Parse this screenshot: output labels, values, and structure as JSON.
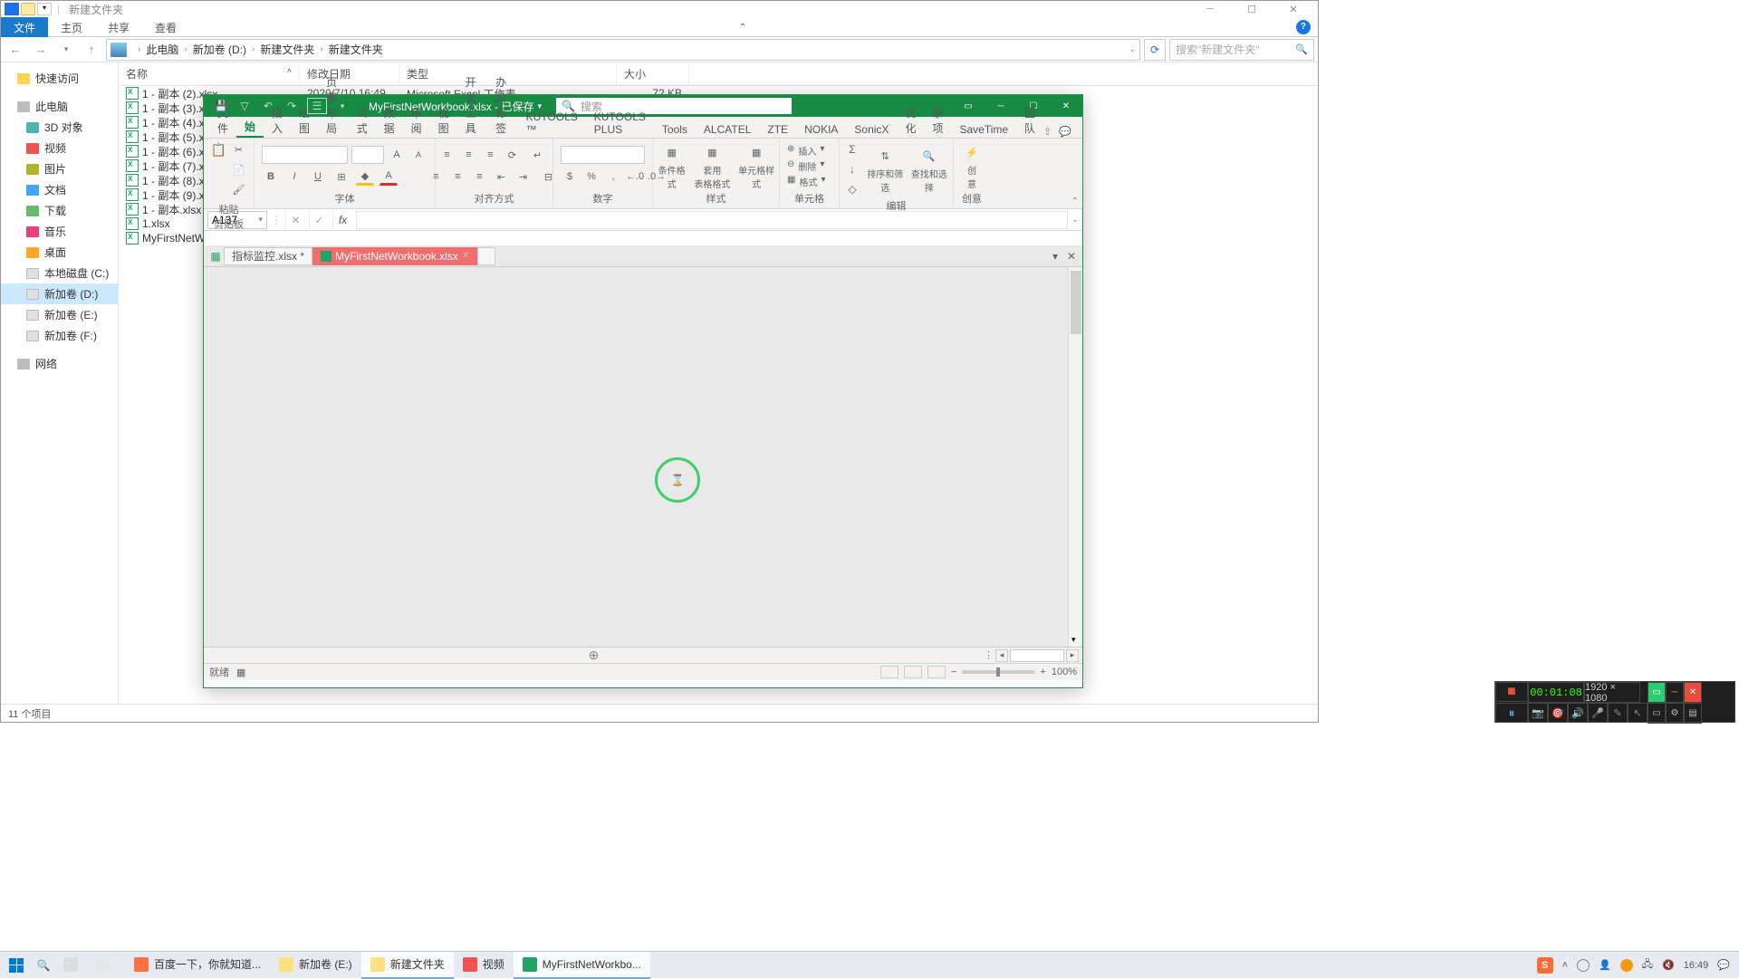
{
  "explorer": {
    "title": "新建文件夹",
    "ribbon_tabs": [
      "文件",
      "主页",
      "共享",
      "查看"
    ],
    "breadcrumb": [
      "此电脑",
      "新加卷 (D:)",
      "新建文件夹",
      "新建文件夹"
    ],
    "search_placeholder": "搜索\"新建文件夹\"",
    "columns": {
      "name": "名称",
      "date": "修改日期",
      "type": "类型",
      "size": "大小"
    },
    "files": [
      {
        "name": "1 - 副本 (2).xlsx",
        "date": "2020/7/10 16:49",
        "type": "Microsoft Excel 工作表",
        "size": "72 KB"
      },
      {
        "name": "1 - 副本 (3).xlsx"
      },
      {
        "name": "1 - 副本 (4).xlsx"
      },
      {
        "name": "1 - 副本 (5).xlsx"
      },
      {
        "name": "1 - 副本 (6).xlsx"
      },
      {
        "name": "1 - 副本 (7).xlsx"
      },
      {
        "name": "1 - 副本 (8).xlsx"
      },
      {
        "name": "1 - 副本 (9).xlsx"
      },
      {
        "name": "1 - 副本.xlsx"
      },
      {
        "name": "1.xlsx"
      },
      {
        "name": "MyFirstNetWorkbo"
      }
    ],
    "sidebar_groups": {
      "quick_access": "快速访问",
      "this_pc": "此电脑",
      "items": [
        {
          "label": "3D 对象",
          "color": "ci-teal"
        },
        {
          "label": "视频",
          "color": "ci-red"
        },
        {
          "label": "图片",
          "color": "ci-olive"
        },
        {
          "label": "文档",
          "color": "ci-blue"
        },
        {
          "label": "下载",
          "color": "ci-green"
        },
        {
          "label": "音乐",
          "color": "ci-pink"
        },
        {
          "label": "桌面",
          "color": "ci-orange"
        },
        {
          "label": "本地磁盘 (C:)",
          "color": "ci-disk"
        },
        {
          "label": "新加卷 (D:)",
          "color": "ci-disk"
        },
        {
          "label": "新加卷 (E:)",
          "color": "ci-disk"
        },
        {
          "label": "新加卷 (F:)",
          "color": "ci-disk"
        }
      ],
      "network": "网络"
    },
    "status": "11 个项目"
  },
  "excel": {
    "title": "MyFirstNetWorkbook.xlsx - 已保存",
    "search_placeholder": "搜索",
    "tabs": [
      "文件",
      "开始",
      "插入",
      "绘图",
      "页面布局",
      "公式",
      "数据",
      "审阅",
      "视图",
      "开发工具",
      "办公标签",
      "KUTOOLS ™",
      "KUTOOLS PLUS",
      "Tools",
      "ALCATEL",
      "ZTE",
      "NOKIA",
      "SonicX",
      "优化",
      "杂项",
      "SaveTime",
      "团队"
    ],
    "active_tab_index": 1,
    "ribbon_groups": {
      "clipboard": "剪贴板",
      "font": "字体",
      "align": "对齐方式",
      "number": "数字",
      "cond": "条件格式",
      "table": "套用\n表格格式",
      "cellstyle": "单元格样式",
      "styles": "样式",
      "insert": "插入",
      "delete": "删除",
      "format": "格式",
      "cells": "单元格",
      "sort": "排序和筛选",
      "find": "查找和选择",
      "edit": "编辑",
      "idea": "创\n意",
      "ideagrp": "创意",
      "paste": "粘贴"
    },
    "name_box": "A137",
    "doc_tabs": [
      {
        "label": "指标监控.xlsx *",
        "active": false
      },
      {
        "label": "MyFirstNetWorkbook.xlsx",
        "active": true
      }
    ],
    "status_ready": "就绪",
    "zoom": "100%"
  },
  "recorder": {
    "dimensions": "1920 × 1080",
    "timer": "00:01:08"
  },
  "taskbar": {
    "items": [
      {
        "label": "",
        "icon": "#e7e7e7"
      },
      {
        "label": "百度一下，你就知道...",
        "icon": "#ff7043"
      },
      {
        "label": "新加卷 (E:)",
        "icon": "#ffe082"
      },
      {
        "label": "新建文件夹",
        "icon": "#ffe082",
        "active": true
      },
      {
        "label": "视频",
        "icon": "#ef5350"
      },
      {
        "label": "MyFirstNetWorkbo...",
        "icon": "#21a366",
        "active": true
      }
    ],
    "ime": "S",
    "time": "16:49"
  }
}
